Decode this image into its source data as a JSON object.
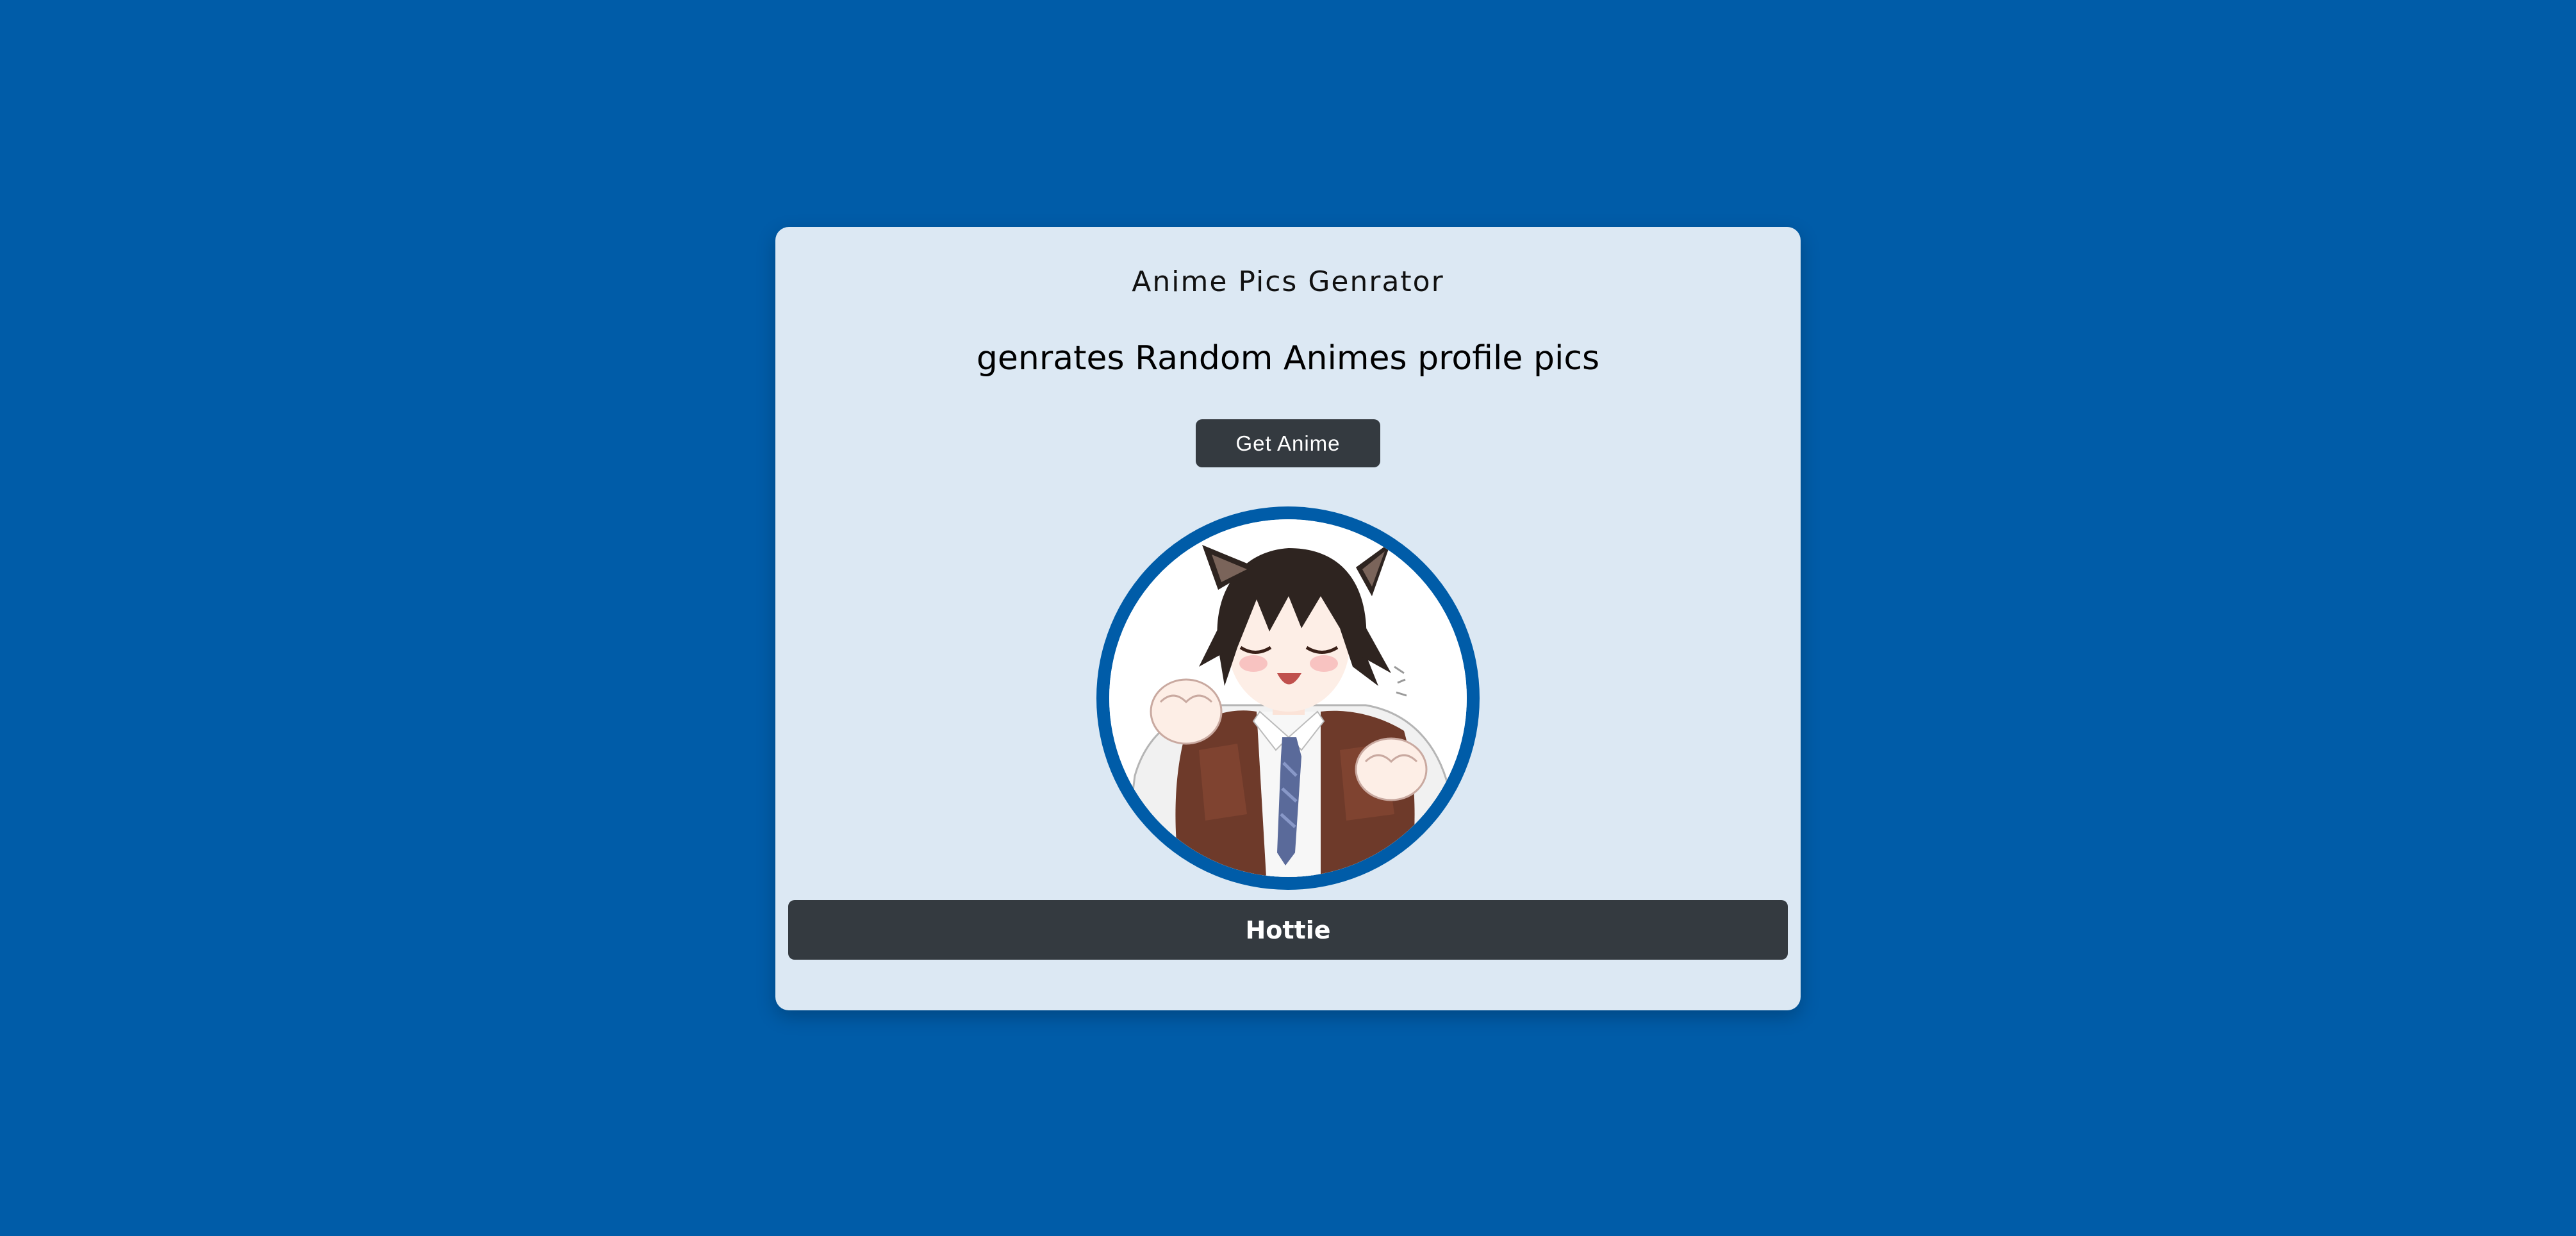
{
  "app": {
    "title": "Anime Pics Genrator",
    "subtitle": "genrates Random Animes profile pics",
    "get_button_label": "Get Anime",
    "result_name": "Hottie",
    "avatar_image": "anime-cat-boy-avatar"
  },
  "colors": {
    "background": "#005ca8",
    "card": "#dce8f3",
    "button": "#343a40",
    "ring": "#005ca8"
  }
}
